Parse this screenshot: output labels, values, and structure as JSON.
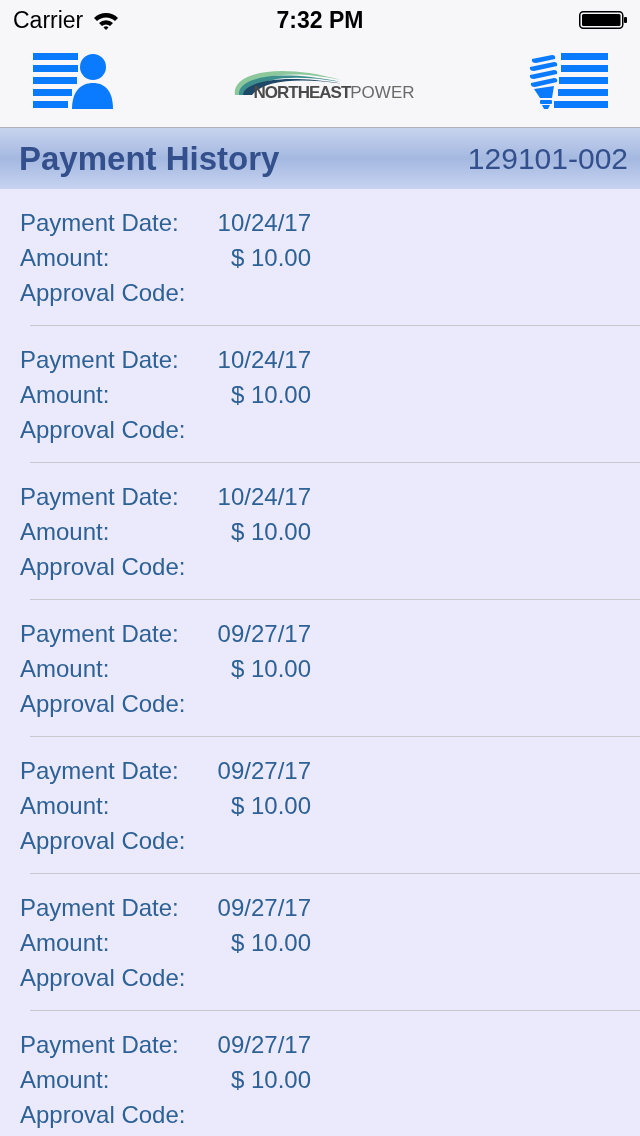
{
  "status_bar": {
    "carrier": "Carrier",
    "time": "7:32 PM"
  },
  "nav_bar": {
    "logo": {
      "name_bold": "NORTHEAST",
      "name_light": "POWER"
    }
  },
  "header": {
    "title": "Payment History",
    "account": "129101-002"
  },
  "payments": [
    {
      "fields": [
        {
          "label": "Payment Date:",
          "value": "10/24/17"
        },
        {
          "label": "Amount:",
          "value": "$ 10.00"
        },
        {
          "label": "Approval Code:"
        }
      ]
    },
    {
      "fields": [
        {
          "label": "Payment Date:",
          "value": "10/24/17"
        },
        {
          "label": "Amount:",
          "value": "$ 10.00"
        },
        {
          "label": "Approval Code:"
        }
      ]
    },
    {
      "fields": [
        {
          "label": "Payment Date:",
          "value": "10/24/17"
        },
        {
          "label": "Amount:",
          "value": "$ 10.00"
        },
        {
          "label": "Approval Code:"
        }
      ]
    },
    {
      "fields": [
        {
          "label": "Payment Date:",
          "value": "09/27/17"
        },
        {
          "label": "Amount:",
          "value": "$ 10.00"
        },
        {
          "label": "Approval Code:"
        }
      ]
    },
    {
      "fields": [
        {
          "label": "Payment Date:",
          "value": "09/27/17"
        },
        {
          "label": "Amount:",
          "value": "$ 10.00"
        },
        {
          "label": "Approval Code:"
        }
      ]
    },
    {
      "fields": [
        {
          "label": "Payment Date:",
          "value": "09/27/17"
        },
        {
          "label": "Amount:",
          "value": "$ 10.00"
        },
        {
          "label": "Approval Code:"
        }
      ]
    },
    {
      "fields": [
        {
          "label": "Payment Date:",
          "value": "09/27/17"
        },
        {
          "label": "Amount:",
          "value": "$ 10.00"
        },
        {
          "label": "Approval Code:"
        }
      ]
    }
  ]
}
